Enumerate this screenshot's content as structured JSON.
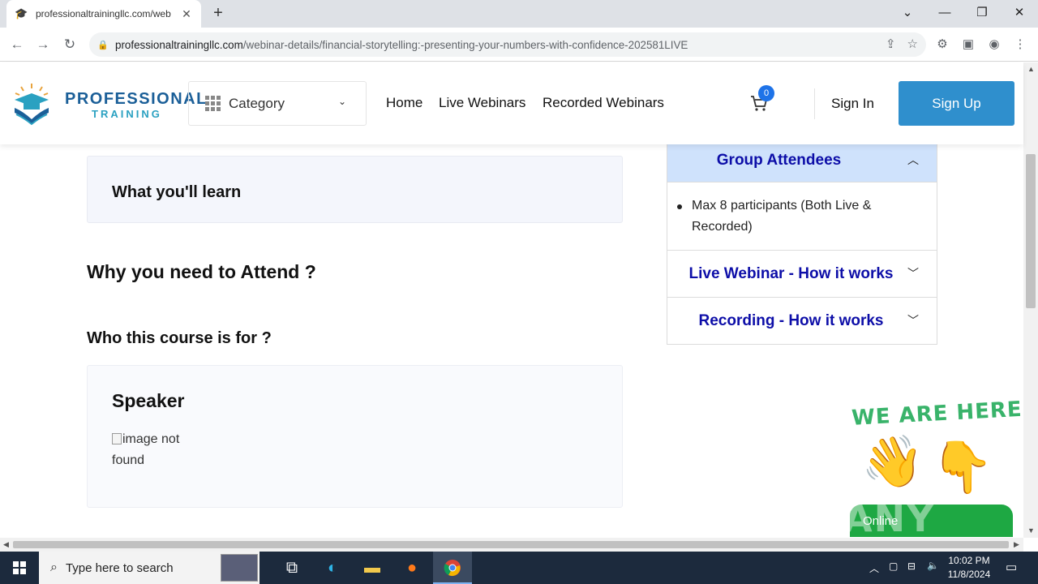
{
  "browser": {
    "tab_title": "professionaltrainingllc.com/web",
    "url_host": "professionaltrainingllc.com",
    "url_path": "/webinar-details/financial-storytelling:-presenting-your-numbers-with-confidence-202581LIVE"
  },
  "header": {
    "logo_line1": "PROFESSIONAL",
    "logo_line2": "TRAINING",
    "category_label": "Category",
    "nav": [
      "Home",
      "Live Webinars",
      "Recorded Webinars"
    ],
    "cart_count": "0",
    "sign_in": "Sign In",
    "sign_up": "Sign Up"
  },
  "content": {
    "learn_title": "What you'll learn",
    "why_title": "Why you need to Attend ?",
    "who_title": "Who this course is for ?",
    "speaker_title": "Speaker",
    "speaker_image_alt": "image not found"
  },
  "sidebar": {
    "group_title": "Group Attendees",
    "group_item": "Max 8 participants (Both Live & Recorded)",
    "live_title": "Live Webinar - How it works",
    "recording_title": "Recording - How it works"
  },
  "chat_widget": {
    "headline": "WE ARE HERE!",
    "status": "Online"
  },
  "taskbar": {
    "search_placeholder": "Type here to search",
    "time": "10:02 PM",
    "date": "11/8/2024"
  },
  "watermark": "ANY RUN"
}
